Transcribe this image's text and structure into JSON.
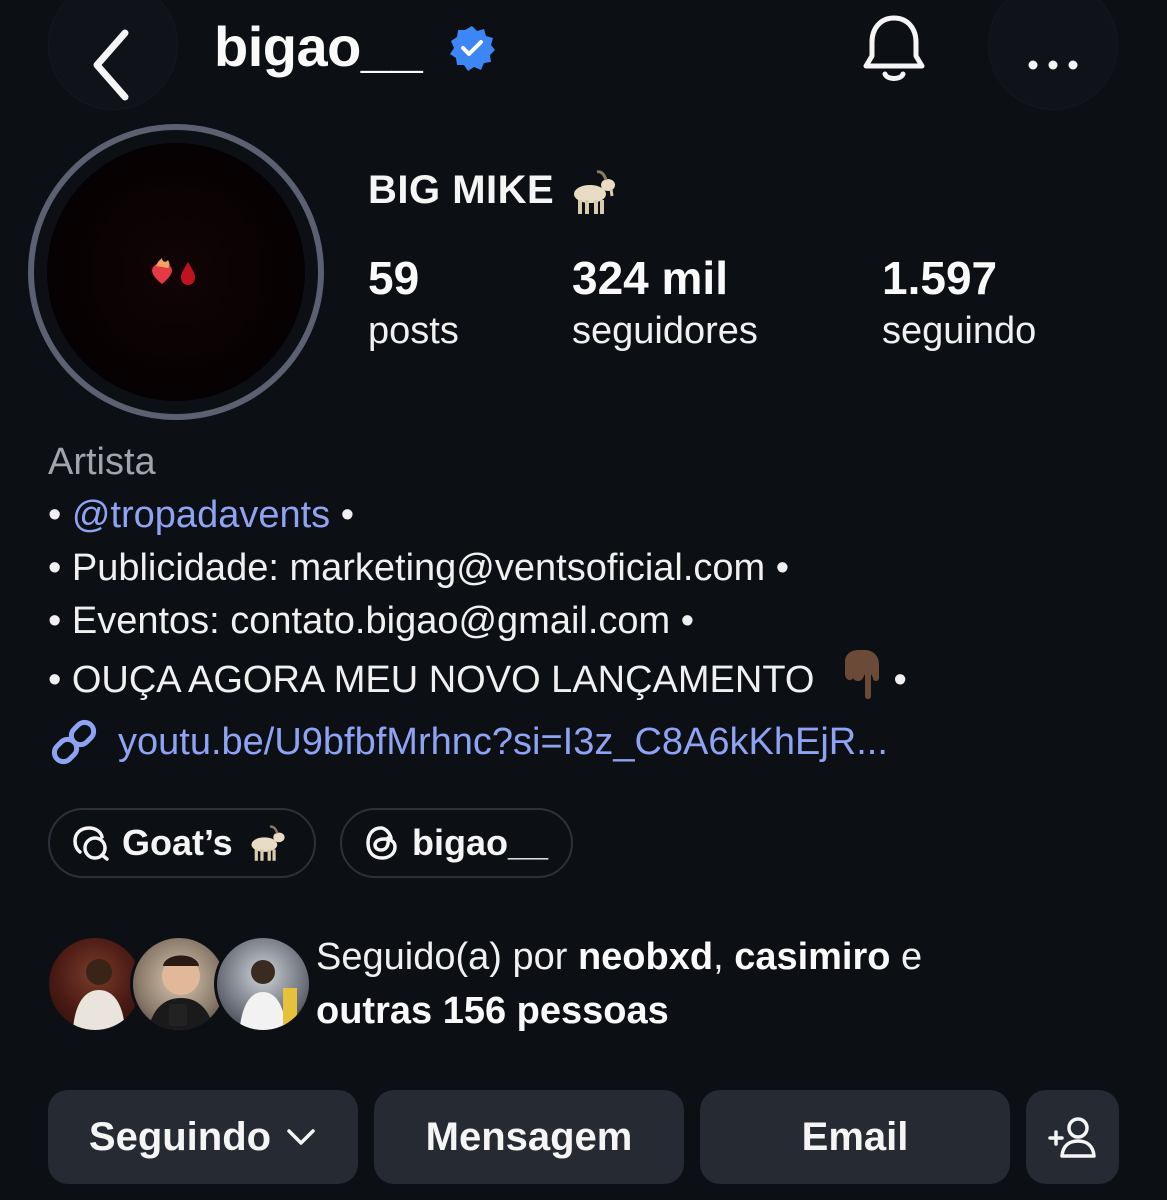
{
  "header": {
    "username": "bigao__",
    "icons": {
      "back": "chevron-left-icon",
      "verified": "verified-badge-icon",
      "notifications": "bell-icon",
      "more": "more-horizontal-icon"
    }
  },
  "profile": {
    "display_name": "BIG MIKE",
    "display_name_emoji": "goat-emoji",
    "avatar_content": "heart-on-fire-and-drop-emoji",
    "stats": [
      {
        "value": "59",
        "label": "posts"
      },
      {
        "value": "324 mil",
        "label": "seguidores"
      },
      {
        "value": "1.597",
        "label": "seguindo"
      }
    ]
  },
  "bio": {
    "category": "Artista",
    "line1_prefix": "• ",
    "line1_mention": "@tropadavents",
    "line1_suffix": " •",
    "line2": "• Publicidade: marketing@ventsoficial.com •",
    "line3": "• Eventos: contato.bigao@gmail.com •",
    "line4_text": "• OUÇA AGORA MEU NOVO LANÇAMENTO ",
    "line4_emoji": "pointing-down-emoji",
    "line4_suffix": " •",
    "link": "youtu.be/U9bfbfMrhnc?si=I3z_C8A6kKhEjR...",
    "link_icon": "link-icon"
  },
  "chips": [
    {
      "label": "Goat’s",
      "icon": "broadcast-channel-icon",
      "emoji": "goat-emoji"
    },
    {
      "label": "bigao__",
      "icon": "threads-icon"
    }
  ],
  "followed_by": {
    "prefix": "Seguido(a) por ",
    "name1": "neobxd",
    "separator": ", ",
    "name2": "casimiro",
    "conjunction": " e",
    "others": "outras 156 pessoas"
  },
  "actions": {
    "following": "Seguindo",
    "message": "Mensagem",
    "email": "Email",
    "add_person_icon": "add-person-icon"
  },
  "colors": {
    "background": "#0c0f14",
    "link": "#8fa3f5",
    "verified": "#3d86f5",
    "button_bg": "#252a33"
  }
}
